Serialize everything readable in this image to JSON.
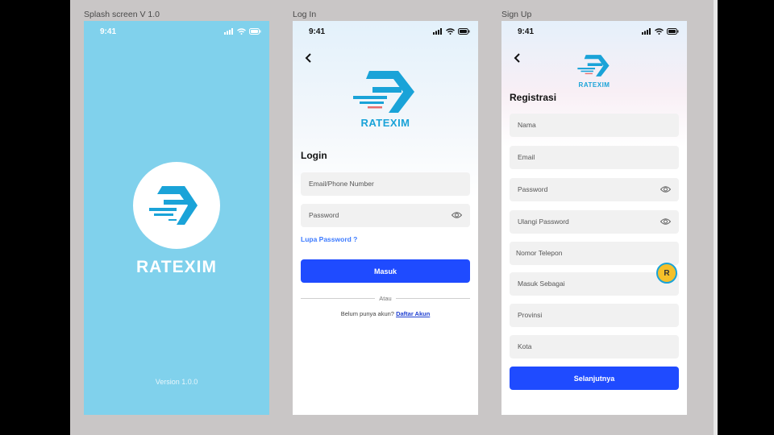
{
  "frames": {
    "splash_label": "Splash screen V 1.0",
    "login_label": "Log In",
    "signup_label": "Sign Up"
  },
  "status": {
    "time": "9:41"
  },
  "brand": {
    "name": "RATEXIM",
    "colors": {
      "primary": "#1aa3d8",
      "accent": "#1f4bff",
      "splash_bg": "#80d1ec"
    }
  },
  "splash": {
    "version": "Version 1.0.0"
  },
  "login": {
    "title": "Login",
    "email_placeholder": "Email/Phone Number",
    "password_placeholder": "Password",
    "forgot": "Lupa Password ?",
    "submit": "Masuk",
    "or": "Atau",
    "no_account": "Belum punya akun?",
    "register_link": "Daftar Akun"
  },
  "signup": {
    "title": "Registrasi",
    "fields": [
      "Nama",
      "Email",
      "Password",
      "Ulangi Password",
      "Nomor Telepon",
      "Masuk Sebagai",
      "Provinsi",
      "Kota"
    ],
    "submit": "Selanjutnya"
  },
  "cursor_badge": "R"
}
